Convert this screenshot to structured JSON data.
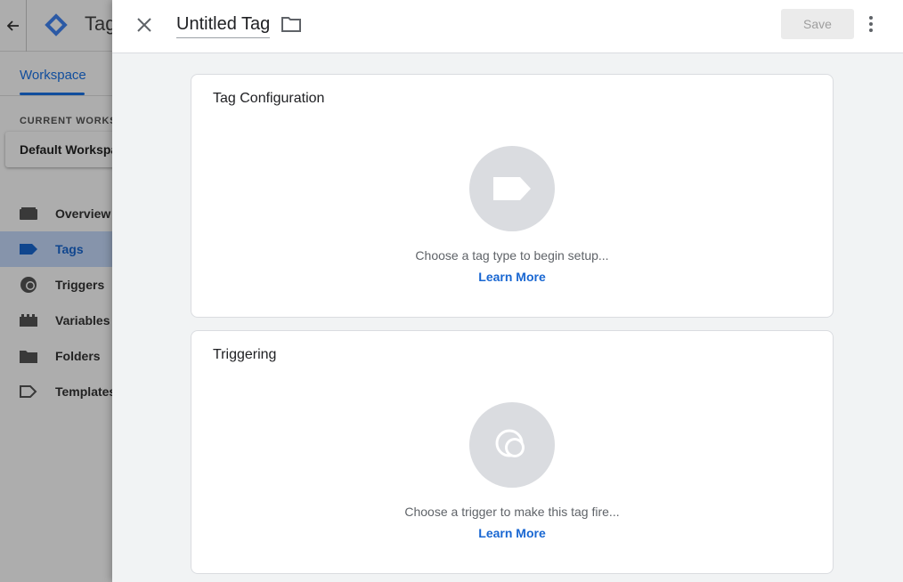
{
  "background": {
    "app_title": "Tag",
    "tabs": [
      {
        "label": "Workspace"
      }
    ],
    "current_workspace_label": "CURRENT WORKSPACE",
    "workspace_name": "Default Workspace",
    "nav": [
      {
        "label": "Overview",
        "icon": "overview-icon"
      },
      {
        "label": "Tags",
        "icon": "tag-icon",
        "active": true
      },
      {
        "label": "Triggers",
        "icon": "trigger-icon"
      },
      {
        "label": "Variables",
        "icon": "variables-icon"
      },
      {
        "label": "Folders",
        "icon": "folder-icon"
      },
      {
        "label": "Templates",
        "icon": "template-icon"
      }
    ]
  },
  "panel": {
    "tag_name": "Untitled Tag",
    "save_label": "Save",
    "tag_configuration": {
      "title": "Tag Configuration",
      "hint": "Choose a tag type to begin setup...",
      "link": "Learn More"
    },
    "triggering": {
      "title": "Triggering",
      "hint": "Choose a trigger to make this tag fire...",
      "link": "Learn More"
    }
  },
  "colors": {
    "accent": "#1a73e8",
    "link": "#1967d2",
    "placeholder_circle": "#dadce0",
    "panel_bg": "#f1f3f4"
  }
}
